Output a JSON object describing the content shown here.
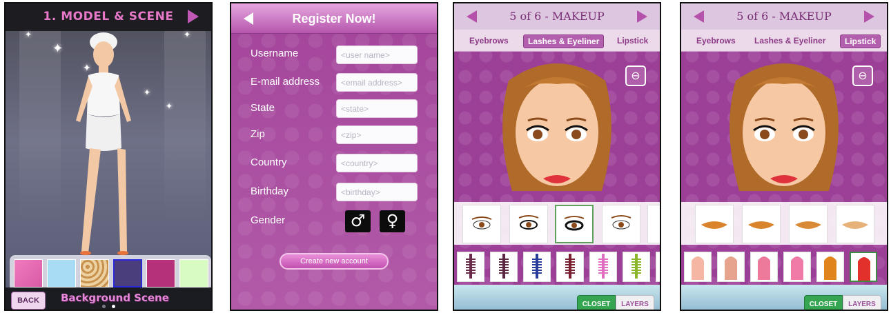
{
  "screen1": {
    "title": "1. MODEL & SCENE",
    "back_label": "BACK",
    "footer_label": "Background Scene",
    "swatches": [
      "#e66fb6",
      "#a8dcf5",
      "#e8c89a",
      "#4a3f7c",
      "#b5327a",
      "#d7fbc0"
    ],
    "page_dots": 2,
    "active_dot": 2
  },
  "screen2": {
    "title": "Register Now!",
    "fields": [
      {
        "label": "Username",
        "placeholder": "<user name>"
      },
      {
        "label": "E-mail address",
        "placeholder": "<email address>"
      },
      {
        "label": "State",
        "placeholder": "<state>"
      },
      {
        "label": "Zip",
        "placeholder": "<zip>"
      },
      {
        "label": "Country",
        "placeholder": "<country>"
      },
      {
        "label": "Birthday",
        "placeholder": "<birthday>"
      }
    ],
    "gender_label": "Gender",
    "gender_male_icon": "male-symbol-icon",
    "gender_female_icon": "female-symbol-icon",
    "create_label": "Create new account"
  },
  "screen3": {
    "title": "5 of 6 - MAKEUP",
    "tabs": [
      "Eyebrows",
      "Lashes & Eyeliner",
      "Lipstick"
    ],
    "active_tab": 1,
    "closet_label": "CLOSET",
    "layers_label": "LAYERS",
    "mascara_colors": [
      "#6a2a4a",
      "#5b2844",
      "#2b3d9a",
      "#7a2030",
      "#e06fbf",
      "#8bb62c",
      "#555555"
    ]
  },
  "screen4": {
    "title": "5 of 6 - MAKEUP",
    "tabs": [
      "Eyebrows",
      "Lashes & Eyeliner",
      "Lipstick"
    ],
    "active_tab": 2,
    "closet_label": "CLOSET",
    "layers_label": "LAYERS",
    "lip_colors": [
      "#d9832d",
      "#d9832d",
      "#d88a36",
      "#e7b27a"
    ],
    "lipstick_colors": [
      "#f5b6a3",
      "#e6a48e",
      "#ee7a9b",
      "#f07ba6",
      "#e0841d",
      "#e2312a"
    ]
  },
  "colors": {
    "brand_pink": "#b552ac",
    "accent_green": "#35a552"
  }
}
